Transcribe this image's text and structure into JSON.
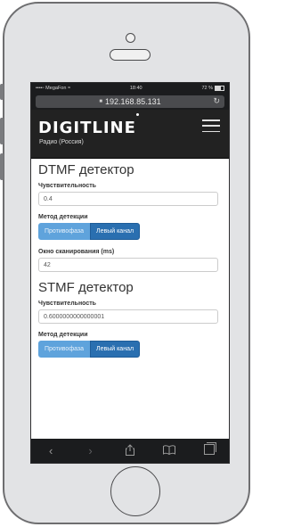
{
  "status_bar": {
    "carrier": "••••◦ MegaFon",
    "wifi": "≈",
    "time": "18:40",
    "battery": "72 %"
  },
  "browser": {
    "url": "192.168.85.131",
    "reload_icon": "reload-icon"
  },
  "header": {
    "logo": "DIGITLINE",
    "subtitle": "Радио (Россия)"
  },
  "dtmf": {
    "title": "DTMF детектор",
    "sensitivity_label": "Чувствительность",
    "sensitivity_value": "0.4",
    "method_label": "Метод детекции",
    "method_options": [
      "Противофаза",
      "Левый канал"
    ],
    "method_selected": "Левый канал",
    "window_label": "Окно сканирования (ms)",
    "window_value": "42"
  },
  "stmf": {
    "title": "STMF детектор",
    "sensitivity_label": "Чувствительность",
    "sensitivity_value": "0.6000000000000001",
    "method_label": "Метод детекции",
    "method_options": [
      "Противофаза",
      "Левый канал"
    ],
    "method_selected": "Левый канал"
  },
  "toolbar": {
    "back": "‹",
    "forward": "›",
    "share_icon": "share-icon",
    "bookmarks_icon": "bookmarks-icon",
    "tabs_icon": "tabs-icon"
  },
  "colors": {
    "accent_dark": "#2a6fb0",
    "accent_light": "#5fa3dc",
    "navbar": "#222222"
  }
}
